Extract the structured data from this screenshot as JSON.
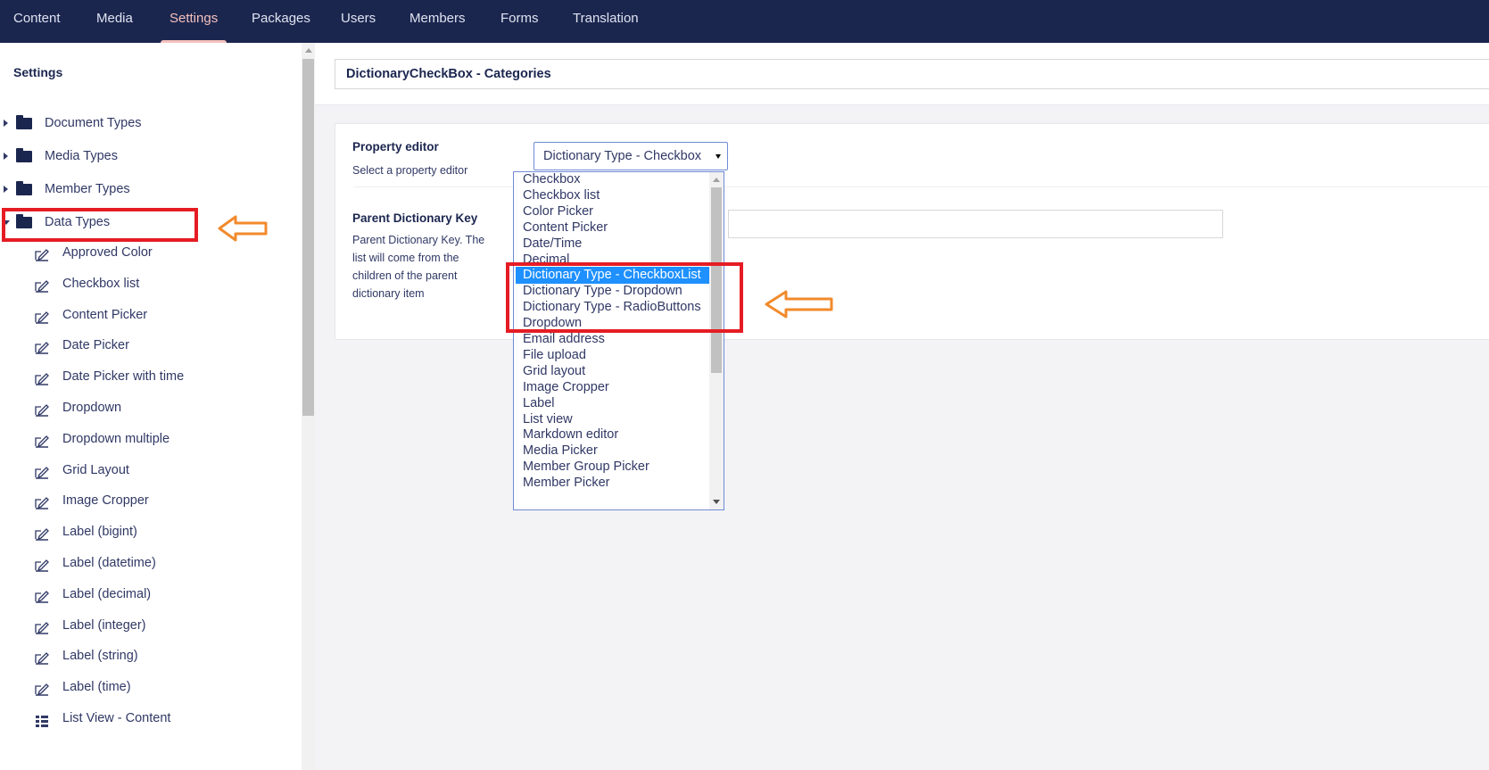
{
  "nav": {
    "tabs": [
      {
        "label": "Content"
      },
      {
        "label": "Media"
      },
      {
        "label": "Settings",
        "active": true
      },
      {
        "label": "Packages"
      },
      {
        "label": "Users"
      },
      {
        "label": "Members"
      },
      {
        "label": "Forms"
      },
      {
        "label": "Translation"
      }
    ]
  },
  "sidebar": {
    "title": "Settings",
    "folders": [
      {
        "label": "Document Types",
        "expanded": false
      },
      {
        "label": "Media Types",
        "expanded": false
      },
      {
        "label": "Member Types",
        "expanded": false
      },
      {
        "label": "Data Types",
        "expanded": true
      }
    ],
    "data_types": [
      {
        "label": "Approved Color",
        "icon": "edit-icon"
      },
      {
        "label": "Checkbox list",
        "icon": "edit-icon"
      },
      {
        "label": "Content Picker",
        "icon": "edit-icon"
      },
      {
        "label": "Date Picker",
        "icon": "edit-icon"
      },
      {
        "label": "Date Picker with time",
        "icon": "edit-icon"
      },
      {
        "label": "Dropdown",
        "icon": "edit-icon"
      },
      {
        "label": "Dropdown multiple",
        "icon": "edit-icon"
      },
      {
        "label": "Grid Layout",
        "icon": "edit-icon"
      },
      {
        "label": "Image Cropper",
        "icon": "edit-icon"
      },
      {
        "label": "Label (bigint)",
        "icon": "edit-icon"
      },
      {
        "label": "Label (datetime)",
        "icon": "edit-icon"
      },
      {
        "label": "Label (decimal)",
        "icon": "edit-icon"
      },
      {
        "label": "Label (integer)",
        "icon": "edit-icon"
      },
      {
        "label": "Label (string)",
        "icon": "edit-icon"
      },
      {
        "label": "Label (time)",
        "icon": "edit-icon"
      },
      {
        "label": "List View - Content",
        "icon": "list-icon"
      }
    ]
  },
  "editor": {
    "name_value": "DictionaryCheckBox - Categories",
    "property_editor": {
      "label": "Property editor",
      "description": "Select a property editor",
      "selected": "Dictionary Type - Checkbox"
    },
    "parent_key": {
      "label": "Parent Dictionary Key",
      "description_lines": [
        "Parent Dictionary Key. The",
        "list will come from the",
        "children of the parent",
        "dictionary item"
      ],
      "value": ""
    },
    "dropdown_options": [
      "Checkbox",
      "Checkbox list",
      "Color Picker",
      "Content Picker",
      "Date/Time",
      "Decimal",
      "Dictionary Type - CheckboxList",
      "Dictionary Type - Dropdown",
      "Dictionary Type - RadioButtons",
      "Dropdown",
      "Email address",
      "File upload",
      "Grid layout",
      "Image Cropper",
      "Label",
      "List view",
      "Markdown editor",
      "Media Picker",
      "Member Group Picker",
      "Member Picker"
    ],
    "highlighted_option": "Dictionary Type - CheckboxList"
  },
  "colors": {
    "nav_bg": "#1b264f",
    "nav_active": "#f5c1bc",
    "highlight": "#1e90ff",
    "annotation_red": "#e51c24",
    "annotation_orange": "#f28a2c"
  }
}
